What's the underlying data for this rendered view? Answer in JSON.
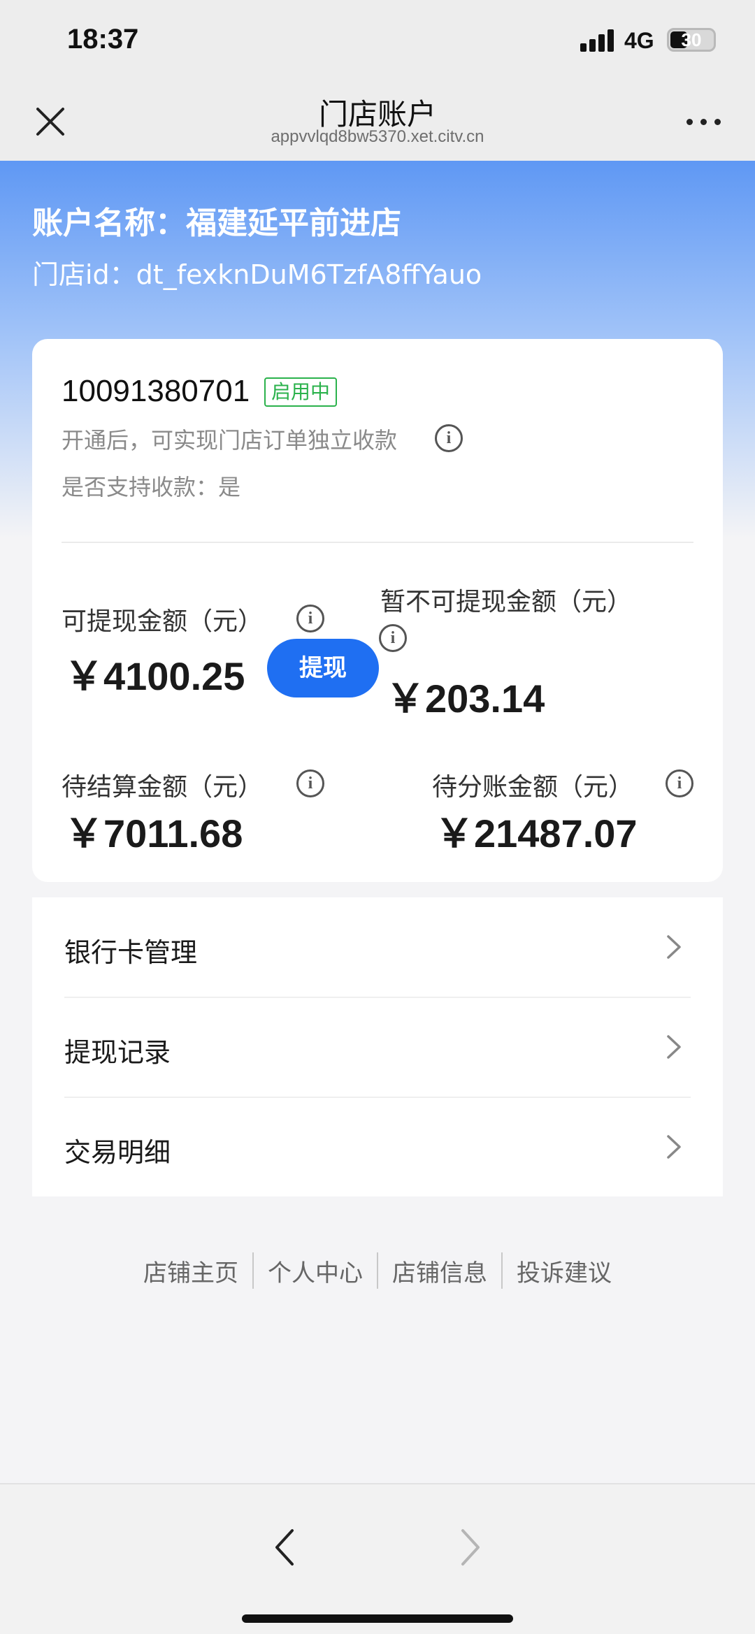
{
  "status_bar": {
    "time": "18:37",
    "network": "4G",
    "battery": "30"
  },
  "nav": {
    "title": "门店账户",
    "url": "appvvlqd8bw5370.xet.citv.cn",
    "close_icon": "close-icon",
    "more_icon": "more-icon"
  },
  "header": {
    "account_name": "账户名称：福建延平前进店",
    "store_id": "门店id：dt_fexknDuM6TzfA8ffYauo"
  },
  "card": {
    "account_number": "10091380701",
    "status_badge": "启用中",
    "description": "开通后，可实现门店订单独立收款",
    "support_label": "是否支持收款：是",
    "withdrawable": {
      "label": "可提现金额（元）",
      "value": "￥4100.25",
      "button": "提现"
    },
    "not_withdrawable": {
      "label": "暂不可提现金额（元）",
      "value": "￥203.14"
    },
    "pending_settlement": {
      "label": "待结算金额（元）",
      "value": "￥7011.68"
    },
    "pending_split": {
      "label": "待分账金额（元）",
      "value": "￥21487.07"
    }
  },
  "menu": {
    "items": [
      {
        "label": "银行卡管理"
      },
      {
        "label": "提现记录"
      },
      {
        "label": "交易明细"
      }
    ]
  },
  "footer": {
    "links": [
      "店铺主页",
      "个人中心",
      "店铺信息",
      "投诉建议"
    ]
  },
  "colors": {
    "accent": "#1f6ff2",
    "badge": "#2bb24c",
    "header_gradient_top": "#5f98f4"
  }
}
